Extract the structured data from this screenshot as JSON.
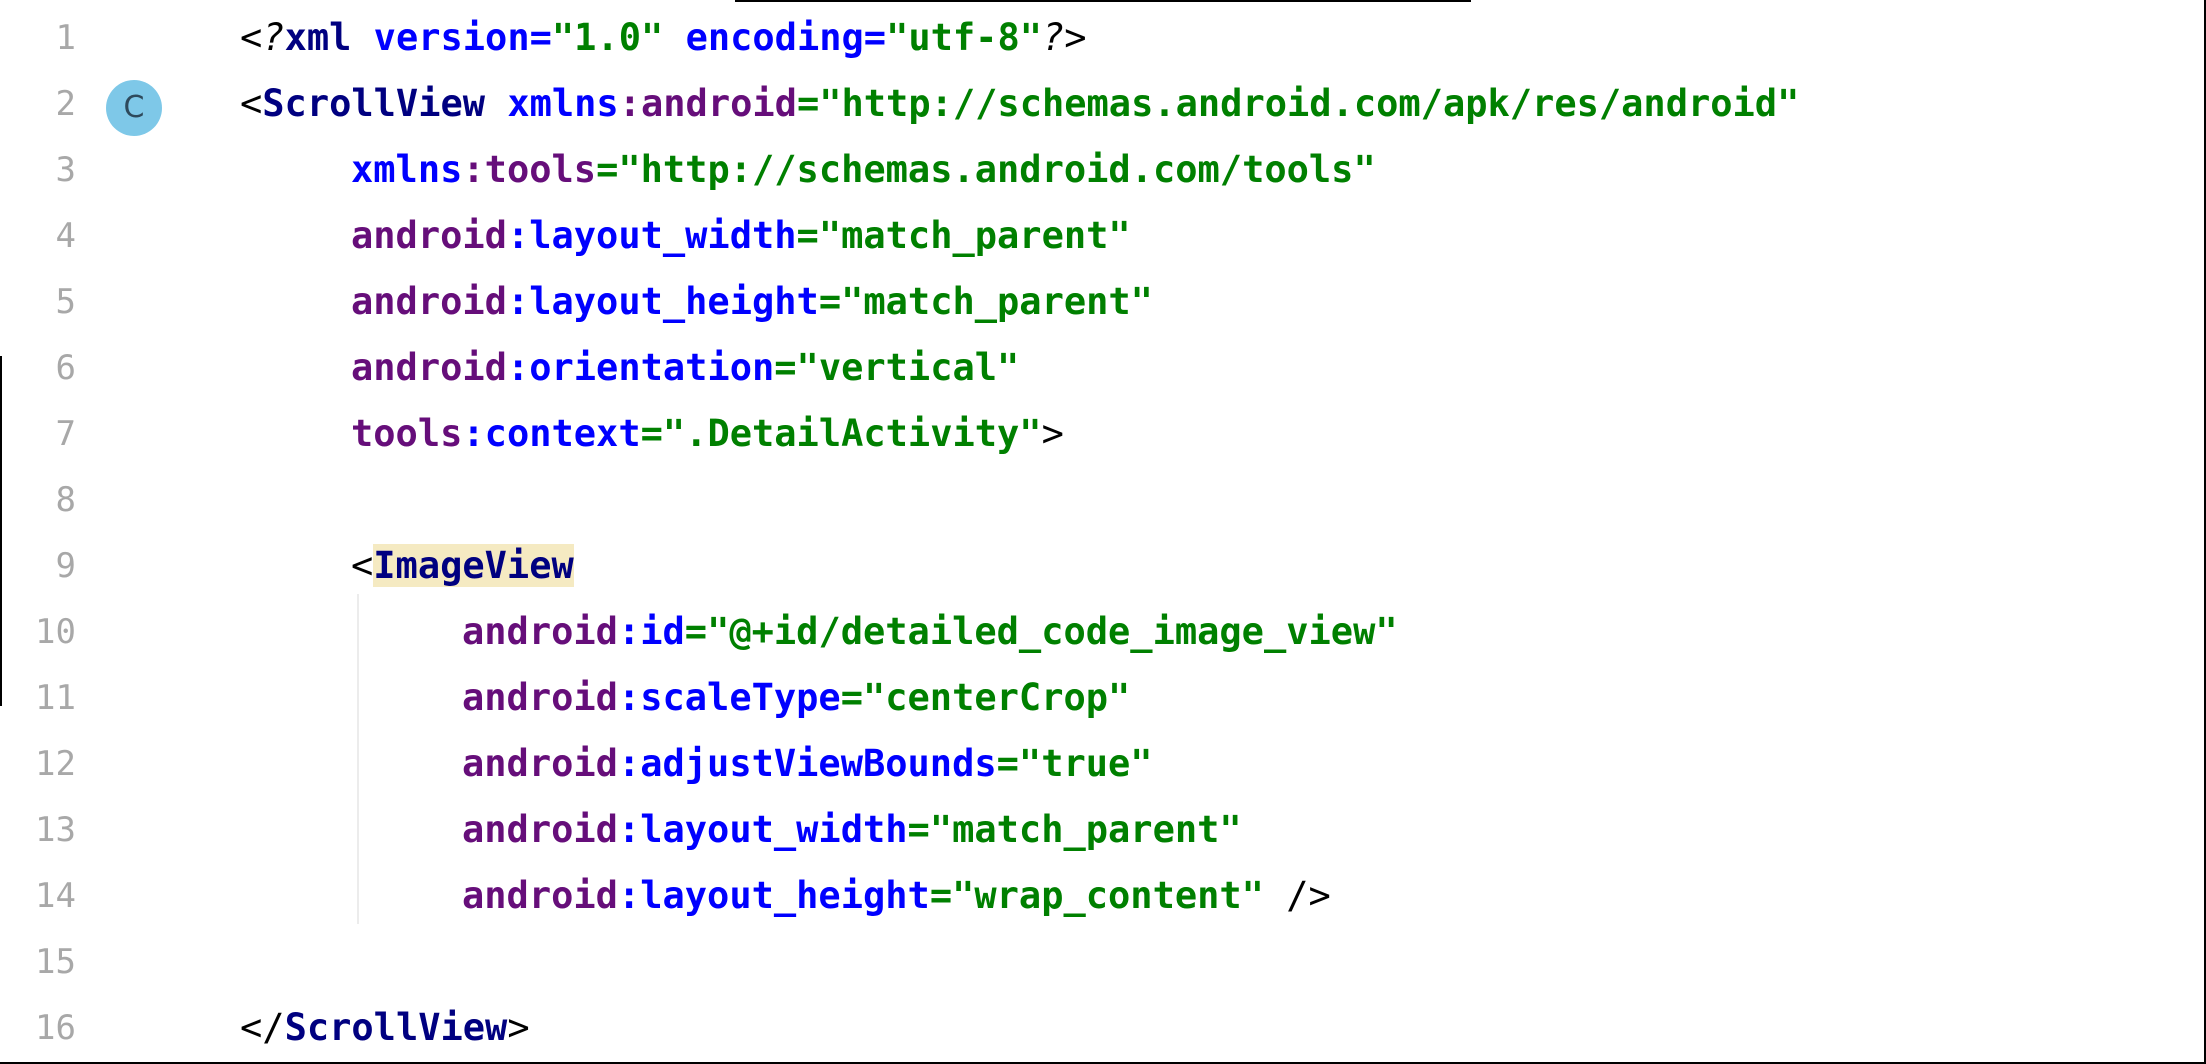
{
  "gutter": {
    "line_numbers": [
      "1",
      "2",
      "3",
      "4",
      "5",
      "6",
      "7",
      "8",
      "9",
      "10",
      "11",
      "12",
      "13",
      "14",
      "15",
      "16"
    ],
    "class_badge": "C"
  },
  "code": {
    "line1": {
      "open": "<?",
      "tag": "xml",
      "attr1": "version",
      "eq1": "=",
      "val1": "\"1.0\"",
      "attr2": "encoding",
      "eq2": "=",
      "val2": "\"utf-8\"",
      "close": "?>"
    },
    "line2": {
      "open": "<",
      "tag": "ScrollView",
      "ns": "xmlns",
      "colon": ":",
      "attr": "android",
      "eq": "=",
      "val": "\"http://schemas.android.com/apk/res/android\""
    },
    "line3": {
      "ns": "xmlns",
      "colon": ":",
      "attr": "tools",
      "eq": "=",
      "val": "\"http://schemas.android.com/tools\""
    },
    "line4": {
      "ns": "android",
      "colon": ":",
      "attr": "layout_width",
      "eq": "=",
      "val": "\"match_parent\""
    },
    "line5": {
      "ns": "android",
      "colon": ":",
      "attr": "layout_height",
      "eq": "=",
      "val": "\"match_parent\""
    },
    "line6": {
      "ns": "android",
      "colon": ":",
      "attr": "orientation",
      "eq": "=",
      "val": "\"vertical\""
    },
    "line7": {
      "ns": "tools",
      "colon": ":",
      "attr": "context",
      "eq": "=",
      "val": "\".DetailActivity\"",
      "close": ">"
    },
    "line9": {
      "open": "<",
      "tag": "ImageView"
    },
    "line10": {
      "ns": "android",
      "colon": ":",
      "attr": "id",
      "eq": "=",
      "val": "\"@+id/detailed_code_image_view\""
    },
    "line11": {
      "ns": "android",
      "colon": ":",
      "attr": "scaleType",
      "eq": "=",
      "val": "\"centerCrop\""
    },
    "line12": {
      "ns": "android",
      "colon": ":",
      "attr": "adjustViewBounds",
      "eq": "=",
      "val": "\"true\""
    },
    "line13": {
      "ns": "android",
      "colon": ":",
      "attr": "layout_width",
      "eq": "=",
      "val": "\"match_parent\""
    },
    "line14": {
      "ns": "android",
      "colon": ":",
      "attr": "layout_height",
      "eq": "=",
      "val": "\"wrap_content\"",
      "close": " />"
    },
    "line16": {
      "open": "</",
      "tag": "ScrollView",
      "close": ">"
    }
  },
  "colors": {
    "tag": "#000080",
    "attribute": "#0000ff",
    "namespace": "#660e7a",
    "value": "#008000",
    "line_number": "#a8a8a8",
    "tag_highlight": "#f5eac2",
    "badge": "#7ec8e8"
  },
  "icons": {
    "class_badge": "class-badge-icon"
  }
}
